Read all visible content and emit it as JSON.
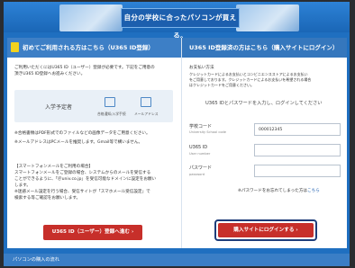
{
  "banner": {
    "title": "自分の学校に合ったパソコンが買える。"
  },
  "left": {
    "header": "初めてご利用される方はこちら（U365 ID登録）",
    "intro": [
      "ご利用いただくにはU365 ID（ユーザー）登録が必要です。下記をご用意の",
      "頂きU365 ID登録へお進みください。"
    ],
    "prep": {
      "label": "入学予定者",
      "item1": "合格通知/入学手続",
      "item2": "メールアドレス"
    },
    "note1": "※合格書類はPDF形式でのファイルなどの画像データをご用意ください。",
    "note2": "※メールアドレスはPCメールを推奨します。Gmail等で構いません。",
    "smartphone_title": "【スマートフォンメールをご利用の場合】",
    "smartphone_body": [
      "スマートフォンメールをご登録の場合、システムからのメールを受信する",
      "ことができるように、「＠univ.co.jp」を受信可能なドメインに設定をお願い",
      "します。",
      "※迷惑メール設定を行う場合、受信サイトが「スマホメール受信設定」で",
      "検索する等ご確認をお願いします。"
    ],
    "register_button": "U365 ID（ユーザー）登録へ進む ›"
  },
  "right": {
    "header": "U365 ID登録済の方はこちら（購入サイトにログイン）",
    "payment_title": "お支払い方法",
    "payment_body": [
      "クレジットカードによるお支払いとコンビニエンスストアによるお支払い",
      "をご用意しております。クレジットカードによるお支払いを希望される場合",
      "はクレジットカードをご用意ください。"
    ],
    "instruction": "U365 IDとパスワードを入力し、ログインしてください",
    "school_code_label": "学校コード",
    "school_code_sub": "University School code",
    "school_code_value": "000012345",
    "id_label": "U365 ID",
    "id_sub": "User number",
    "id_value": "",
    "password_label": "パスワード",
    "password_sub": "password",
    "password_value": "",
    "forgot": "※パスワードをお忘れてしまった方は",
    "forgot_link": "こちら",
    "login_button": "購入サイトにログインする ›"
  },
  "footer": {
    "label": "パソコンの購入の流れ"
  },
  "colors": {
    "brand_blue": "#1f6fc0",
    "accent_red": "#c72f2a",
    "login_border": "#1e3d7a"
  }
}
